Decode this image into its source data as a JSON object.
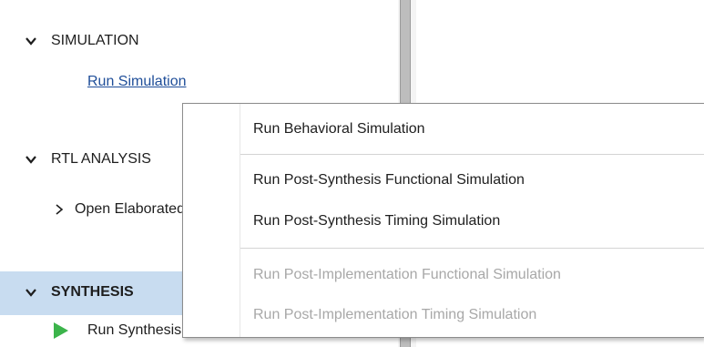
{
  "flow_navigator": {
    "sections": [
      {
        "title": "SIMULATION",
        "expanded": true,
        "items": [
          {
            "label": "Run Simulation",
            "style": "link"
          }
        ]
      },
      {
        "title": "RTL ANALYSIS",
        "expanded": true,
        "items": [
          {
            "label": "Open Elaborated Design",
            "style": "collapsed-group"
          }
        ]
      },
      {
        "title": "SYNTHESIS",
        "expanded": true,
        "selected": true,
        "items": [
          {
            "label": "Run Synthesis",
            "style": "run",
            "icon": "play-icon"
          }
        ]
      }
    ]
  },
  "context_menu": {
    "items": [
      {
        "label": "Run Behavioral Simulation",
        "enabled": true
      },
      {
        "label": "Run Post-Synthesis Functional Simulation",
        "enabled": true
      },
      {
        "label": "Run Post-Synthesis Timing Simulation",
        "enabled": true
      },
      {
        "label": "Run Post-Implementation Functional Simulation",
        "enabled": false
      },
      {
        "label": "Run Post-Implementation Timing Simulation",
        "enabled": false
      }
    ]
  },
  "colors": {
    "link": "#1f4e99",
    "selected_section_bg": "#c8dcf0",
    "disabled_text": "#a8a8a8",
    "run_icon": "#3cb44b"
  }
}
